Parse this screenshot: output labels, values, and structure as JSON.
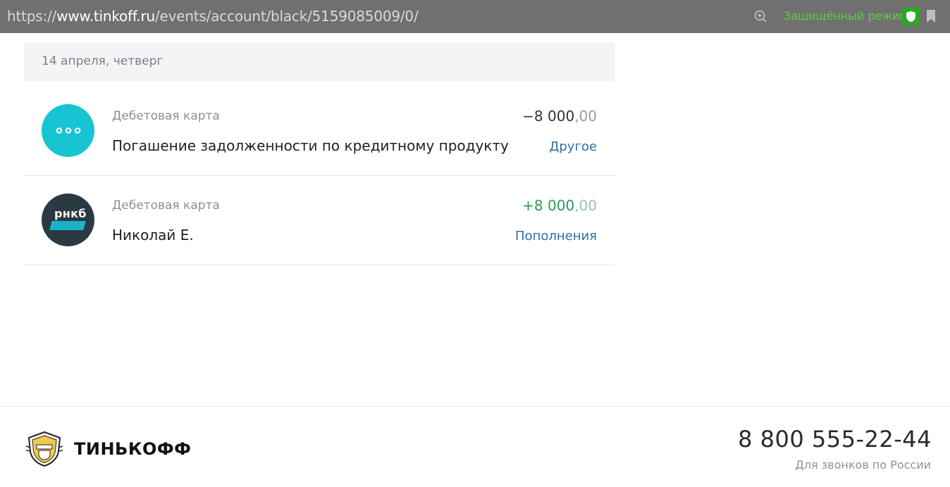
{
  "browser": {
    "url_prefix": "https://",
    "url_domain": "www.tinkoff.ru",
    "url_path": "/events/account/black/5159085009/0/",
    "secure_mode_label": "Защищённый режим",
    "icons": [
      "zoom-icon",
      "shield-icon",
      "bookmark-icon"
    ]
  },
  "operations": {
    "date_label": "14 апреля, четверг",
    "items": [
      {
        "account": "Дебетовая карта",
        "title": "Погашение задолженности по кредитному продукту",
        "amount_main": "−8 000",
        "amount_fraction": ",00",
        "category": "Другое",
        "icon": "more-dots-icon"
      },
      {
        "account": "Дебетовая карта",
        "title": "Николай Е.",
        "amount_main": "+8 000",
        "amount_fraction": ",00",
        "category": "Пополнения",
        "icon": "rnkb-logo",
        "logo_text": "рнкб"
      }
    ]
  },
  "footer": {
    "brand": "ТИНЬКОФФ",
    "phone": "8 800 555-22-44",
    "phone_caption": "Для звонков по России"
  },
  "colors": {
    "accent_cyan": "#17c4d1",
    "positive_green": "#2e9a5a",
    "link_blue": "#336fa0",
    "secure_green": "#5bcf3a"
  }
}
